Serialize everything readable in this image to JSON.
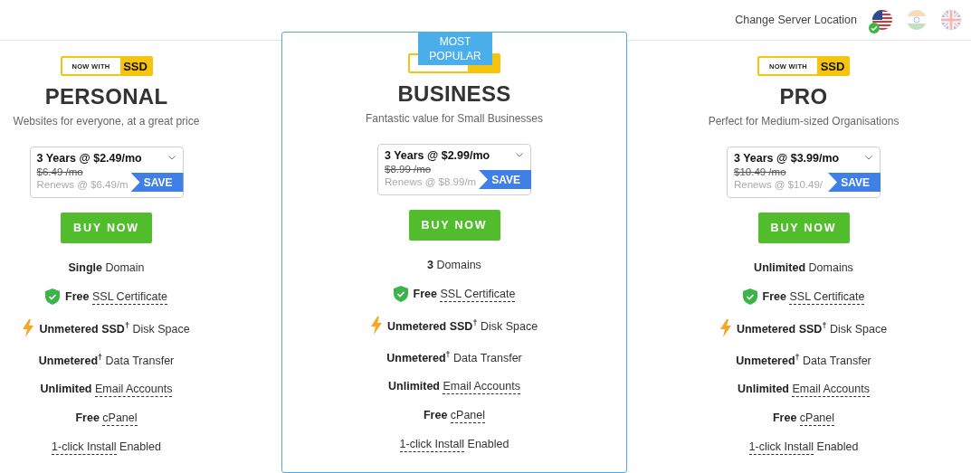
{
  "header": {
    "label": "Change Server Location",
    "locations": [
      {
        "kind": "us",
        "selected": true
      },
      {
        "kind": "in",
        "selected": false
      },
      {
        "kind": "uk",
        "selected": false
      }
    ]
  },
  "plans": [
    {
      "name": "PERSONAL",
      "ssd_badge": {
        "left": "NOW WITH",
        "right": "SSD"
      },
      "subtitle": "Websites for everyone, at a great price",
      "term": "3 Years @ $2.49/mo",
      "old_price": "$6.49 /mo",
      "renews": "Renews @ $6.49/m",
      "save": "SAVE",
      "button": "BUY NOW",
      "features": [
        {
          "kind": "none",
          "segments": [
            {
              "kind": "bold",
              "text": "Single"
            },
            {
              "kind": "plain",
              "text": "Domain"
            }
          ]
        },
        {
          "kind": "shield",
          "segments": [
            {
              "kind": "bold",
              "text": "Free"
            },
            {
              "kind": "link",
              "text": "SSL Certificate"
            }
          ]
        },
        {
          "kind": "bolt",
          "segments": [
            {
              "kind": "bold",
              "text": "Unmetered SSD"
            },
            {
              "kind": "sup",
              "text": "†"
            },
            {
              "kind": "plain",
              "text": "Disk Space"
            }
          ]
        },
        {
          "kind": "none",
          "segments": [
            {
              "kind": "bold",
              "text": "Unmetered"
            },
            {
              "kind": "sup",
              "text": "†"
            },
            {
              "kind": "plain",
              "text": "Data Transfer"
            }
          ]
        },
        {
          "kind": "none",
          "segments": [
            {
              "kind": "bold",
              "text": "Unlimited"
            },
            {
              "kind": "link",
              "text": "Email Accounts"
            }
          ]
        },
        {
          "kind": "none",
          "segments": [
            {
              "kind": "bold",
              "text": "Free"
            },
            {
              "kind": "link",
              "text": "cPanel"
            }
          ]
        },
        {
          "kind": "none",
          "segments": [
            {
              "kind": "link",
              "text": "1-click Install"
            },
            {
              "kind": "plain",
              "text": "Enabled"
            }
          ]
        }
      ]
    },
    {
      "name": "BUSINESS",
      "ribbon": "MOST POPULAR",
      "subtitle": "Fantastic value for Small Businesses",
      "term": "3 Years @ $2.99/mo",
      "old_price": "$8.99 /mo",
      "renews": "Renews @ $8.99/m",
      "save": "SAVE",
      "button": "BUY NOW",
      "features": [
        {
          "kind": "none",
          "segments": [
            {
              "kind": "bold",
              "text": "3"
            },
            {
              "kind": "plain",
              "text": "Domains"
            }
          ]
        },
        {
          "kind": "shield",
          "segments": [
            {
              "kind": "bold",
              "text": "Free"
            },
            {
              "kind": "link",
              "text": "SSL Certificate"
            }
          ]
        },
        {
          "kind": "bolt",
          "segments": [
            {
              "kind": "bold",
              "text": "Unmetered SSD"
            },
            {
              "kind": "sup",
              "text": "†"
            },
            {
              "kind": "plain",
              "text": "Disk Space"
            }
          ]
        },
        {
          "kind": "none",
          "segments": [
            {
              "kind": "bold",
              "text": "Unmetered"
            },
            {
              "kind": "sup",
              "text": "†"
            },
            {
              "kind": "plain",
              "text": "Data Transfer"
            }
          ]
        },
        {
          "kind": "none",
          "segments": [
            {
              "kind": "bold",
              "text": "Unlimited"
            },
            {
              "kind": "link",
              "text": "Email Accounts"
            }
          ]
        },
        {
          "kind": "none",
          "segments": [
            {
              "kind": "bold",
              "text": "Free"
            },
            {
              "kind": "link",
              "text": "cPanel"
            }
          ]
        },
        {
          "kind": "none",
          "segments": [
            {
              "kind": "link",
              "text": "1-click Install"
            },
            {
              "kind": "plain",
              "text": "Enabled"
            }
          ]
        }
      ]
    },
    {
      "name": "PRO",
      "ssd_badge": {
        "left": "NOW WITH",
        "right": "SSD"
      },
      "subtitle": "Perfect for Medium-sized Organisations",
      "term": "3 Years @ $3.99/mo",
      "old_price": "$10.49 /mo",
      "renews": "Renews @ $10.49/",
      "save": "SAVE",
      "button": "BUY NOW",
      "features": [
        {
          "kind": "none",
          "segments": [
            {
              "kind": "bold",
              "text": "Unlimited"
            },
            {
              "kind": "plain",
              "text": "Domains"
            }
          ]
        },
        {
          "kind": "shield",
          "segments": [
            {
              "kind": "bold",
              "text": "Free"
            },
            {
              "kind": "link",
              "text": "SSL Certificate"
            }
          ]
        },
        {
          "kind": "bolt",
          "segments": [
            {
              "kind": "bold",
              "text": "Unmetered SSD"
            },
            {
              "kind": "sup",
              "text": "†"
            },
            {
              "kind": "plain",
              "text": "Disk Space"
            }
          ]
        },
        {
          "kind": "none",
          "segments": [
            {
              "kind": "bold",
              "text": "Unmetered"
            },
            {
              "kind": "sup",
              "text": "†"
            },
            {
              "kind": "plain",
              "text": "Data Transfer"
            }
          ]
        },
        {
          "kind": "none",
          "segments": [
            {
              "kind": "bold",
              "text": "Unlimited"
            },
            {
              "kind": "link",
              "text": "Email Accounts"
            }
          ]
        },
        {
          "kind": "none",
          "segments": [
            {
              "kind": "bold",
              "text": "Free"
            },
            {
              "kind": "link",
              "text": "cPanel"
            }
          ]
        },
        {
          "kind": "none",
          "segments": [
            {
              "kind": "link",
              "text": "1-click Install"
            },
            {
              "kind": "plain",
              "text": "Enabled"
            }
          ]
        }
      ]
    }
  ]
}
